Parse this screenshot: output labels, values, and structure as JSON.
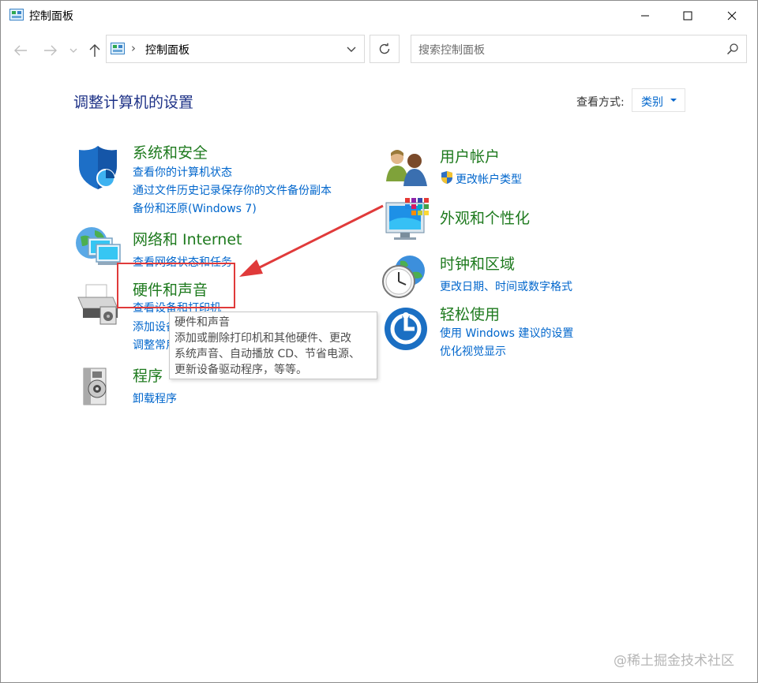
{
  "window": {
    "title": "控制面板",
    "controls": {
      "minimize": "minimize-icon",
      "maximize": "maximize-icon",
      "close": "close-icon"
    }
  },
  "navigation": {
    "back": "back-arrow-icon",
    "forward": "forward-arrow-icon",
    "recent": "chevron-down-icon",
    "up": "up-arrow-icon",
    "breadcrumb": "控制面板",
    "refresh": "refresh-icon"
  },
  "search": {
    "placeholder": "搜索控制面板"
  },
  "header": {
    "title": "调整计算机的设置",
    "view_by_label": "查看方式:",
    "view_by_value": "类别"
  },
  "categories": {
    "system_security": {
      "title": "系统和安全",
      "links": [
        "查看你的计算机状态",
        "通过文件历史记录保存你的文件备份副本",
        "备份和还原(Windows 7)"
      ]
    },
    "network": {
      "title": "网络和 Internet",
      "links": [
        "查看网络状态和任务"
      ]
    },
    "hardware": {
      "title": "硬件和声音",
      "links": [
        "查看设备和打印机",
        "添加设备",
        "调整常用移动设置"
      ]
    },
    "programs": {
      "title": "程序",
      "links": [
        "卸载程序"
      ]
    },
    "user_accounts": {
      "title": "用户帐户",
      "links": [
        "更改帐户类型"
      ]
    },
    "appearance": {
      "title": "外观和个性化",
      "links": []
    },
    "clock_region": {
      "title": "时钟和区域",
      "links": [
        "更改日期、时间或数字格式"
      ]
    },
    "ease_of_access": {
      "title": "轻松使用",
      "links": [
        "使用 Windows 建议的设置",
        "优化视觉显示"
      ]
    }
  },
  "tooltip": {
    "lines": [
      "硬件和声音",
      "添加或删除打印机和其他硬件、更改",
      "系统声音、自动播放 CD、节省电源、",
      "更新设备驱动程序，等等。"
    ]
  },
  "annotation": {
    "arrow_color": "#e03a3a",
    "box_color": "#e03a3a"
  },
  "watermark": "@稀土掘金技术社区",
  "colors": {
    "category_title": "#1e7a1e",
    "link": "#0066cc",
    "page_title": "#1e3287"
  }
}
